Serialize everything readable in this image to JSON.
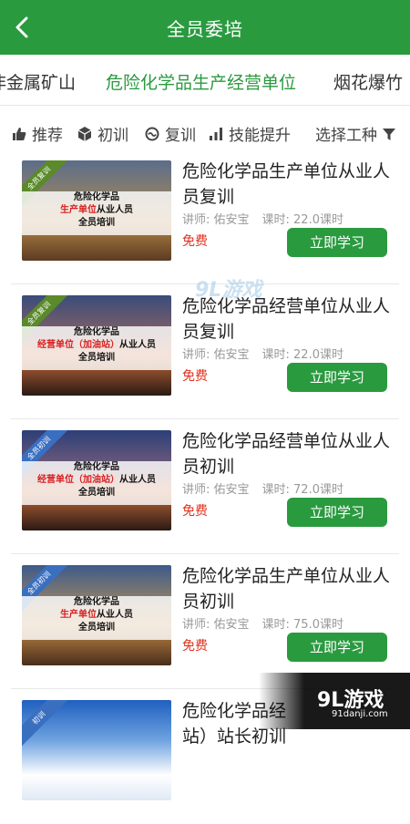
{
  "header": {
    "title": "全员委培",
    "back": "back"
  },
  "tabs": [
    {
      "label": "非金属矿山",
      "active": false
    },
    {
      "label": "危险化学品生产经营单位",
      "active": true
    },
    {
      "label": "烟花爆竹",
      "active": false
    }
  ],
  "filters": [
    {
      "label": "推荐",
      "icon": "thumbs-up-icon"
    },
    {
      "label": "初训",
      "icon": "cube-icon"
    },
    {
      "label": "复训",
      "icon": "refresh-icon"
    },
    {
      "label": "技能提升",
      "icon": "bar-chart-icon"
    },
    {
      "label": "选择工种",
      "icon": "funnel-icon"
    }
  ],
  "courses": [
    {
      "title": "危险化学品生产单位从业人员复训",
      "teacher": "讲师: 佑安宝",
      "hours": "课时: 22.0课时",
      "price": "免费",
      "button": "立即学习",
      "thumb": {
        "line1": "危险化学品",
        "line2_red": "生产单位",
        "line2": "从业人员",
        "line3": "全员培训",
        "ribbon": "全员复训",
        "ribbon_color": "#5a8a2a"
      }
    },
    {
      "title": "危险化学品经营单位从业人员复训",
      "teacher": "讲师: 佑安宝",
      "hours": "课时: 22.0课时",
      "price": "免费",
      "button": "立即学习",
      "thumb": {
        "line1": "危险化学品",
        "line2_red": "经营单位（加油站）",
        "line2": "从业人员",
        "line3": "全员培训",
        "ribbon": "全员复训",
        "ribbon_color": "#5a8a2a"
      }
    },
    {
      "title": "危险化学品经营单位从业人员初训",
      "teacher": "讲师: 佑安宝",
      "hours": "课时: 72.0课时",
      "price": "免费",
      "button": "立即学习",
      "thumb": {
        "line1": "危险化学品",
        "line2_red": "经营单位（加油站）",
        "line2": "从业人员",
        "line3": "全员培训",
        "ribbon": "全员初训",
        "ribbon_color": "#3a6fc0"
      }
    },
    {
      "title": "危险化学品生产单位从业人员初训",
      "teacher": "讲师: 佑安宝",
      "hours": "课时: 75.0课时",
      "price": "免费",
      "button": "立即学习",
      "thumb": {
        "line1": "危险化学品",
        "line2_red": "生产单位",
        "line2": "从业人员",
        "line3": "全员培训",
        "ribbon": "全员初训",
        "ribbon_color": "#3a6fc0"
      }
    },
    {
      "title": "危险化学品经",
      "subtitle": "站）站长初训",
      "thumb": {
        "ribbon": "初训",
        "ribbon_color": "#3a6fc0"
      }
    }
  ],
  "watermarks": {
    "center": "9L游戏",
    "corner_big": "9L游戏",
    "corner_small": "91danji.com"
  },
  "colors": {
    "primary": "#2a9a3f",
    "price": "#e0301e"
  }
}
